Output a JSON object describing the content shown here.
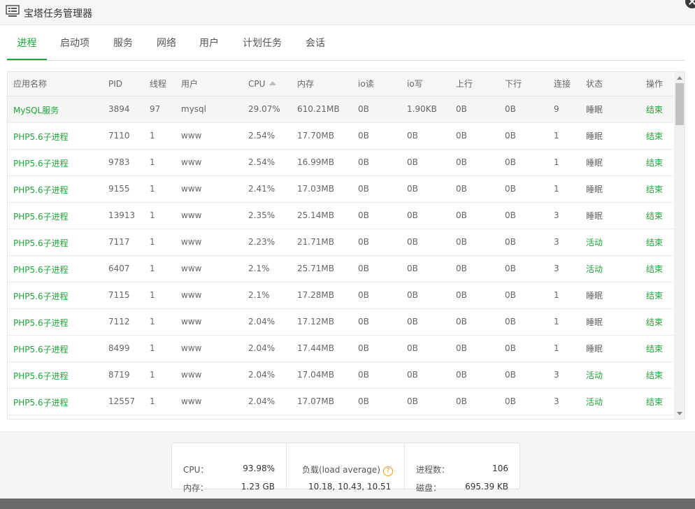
{
  "window": {
    "title": "宝塔任务管理器"
  },
  "tabs": [
    {
      "label": "进程",
      "active": true
    },
    {
      "label": "启动项"
    },
    {
      "label": "服务"
    },
    {
      "label": "网络"
    },
    {
      "label": "用户"
    },
    {
      "label": "计划任务"
    },
    {
      "label": "会话"
    }
  ],
  "table": {
    "columns": [
      "应用名称",
      "PID",
      "线程",
      "用户",
      "CPU",
      "内存",
      "io读",
      "io写",
      "上行",
      "下行",
      "连接",
      "状态",
      "操作"
    ],
    "sort_column": "CPU",
    "rows": [
      {
        "name": "MySQL服务",
        "pid": "3894",
        "threads": "97",
        "user": "mysql",
        "cpu": "29.07%",
        "mem": "610.21MB",
        "io_read": "0B",
        "io_write": "1.90KB",
        "up": "0B",
        "down": "0B",
        "conn": "9",
        "status": "睡眠",
        "active": false,
        "op": "结束"
      },
      {
        "name": "PHP5.6子进程",
        "pid": "7110",
        "threads": "1",
        "user": "www",
        "cpu": "2.54%",
        "mem": "17.70MB",
        "io_read": "0B",
        "io_write": "0B",
        "up": "0B",
        "down": "0B",
        "conn": "1",
        "status": "睡眠",
        "active": false,
        "op": "结束"
      },
      {
        "name": "PHP5.6子进程",
        "pid": "9783",
        "threads": "1",
        "user": "www",
        "cpu": "2.54%",
        "mem": "16.99MB",
        "io_read": "0B",
        "io_write": "0B",
        "up": "0B",
        "down": "0B",
        "conn": "1",
        "status": "睡眠",
        "active": false,
        "op": "结束"
      },
      {
        "name": "PHP5.6子进程",
        "pid": "9155",
        "threads": "1",
        "user": "www",
        "cpu": "2.41%",
        "mem": "17.03MB",
        "io_read": "0B",
        "io_write": "0B",
        "up": "0B",
        "down": "0B",
        "conn": "1",
        "status": "睡眠",
        "active": false,
        "op": "结束"
      },
      {
        "name": "PHP5.6子进程",
        "pid": "13913",
        "threads": "1",
        "user": "www",
        "cpu": "2.35%",
        "mem": "25.14MB",
        "io_read": "0B",
        "io_write": "0B",
        "up": "0B",
        "down": "0B",
        "conn": "3",
        "status": "睡眠",
        "active": false,
        "op": "结束"
      },
      {
        "name": "PHP5.6子进程",
        "pid": "7117",
        "threads": "1",
        "user": "www",
        "cpu": "2.23%",
        "mem": "21.71MB",
        "io_read": "0B",
        "io_write": "0B",
        "up": "0B",
        "down": "0B",
        "conn": "3",
        "status": "活动",
        "active": true,
        "op": "结束"
      },
      {
        "name": "PHP5.6子进程",
        "pid": "6407",
        "threads": "1",
        "user": "www",
        "cpu": "2.1%",
        "mem": "25.71MB",
        "io_read": "0B",
        "io_write": "0B",
        "up": "0B",
        "down": "0B",
        "conn": "3",
        "status": "活动",
        "active": true,
        "op": "结束"
      },
      {
        "name": "PHP5.6子进程",
        "pid": "7115",
        "threads": "1",
        "user": "www",
        "cpu": "2.1%",
        "mem": "17.28MB",
        "io_read": "0B",
        "io_write": "0B",
        "up": "0B",
        "down": "0B",
        "conn": "1",
        "status": "睡眠",
        "active": false,
        "op": "结束"
      },
      {
        "name": "PHP5.6子进程",
        "pid": "7112",
        "threads": "1",
        "user": "www",
        "cpu": "2.04%",
        "mem": "17.12MB",
        "io_read": "0B",
        "io_write": "0B",
        "up": "0B",
        "down": "0B",
        "conn": "1",
        "status": "睡眠",
        "active": false,
        "op": "结束"
      },
      {
        "name": "PHP5.6子进程",
        "pid": "8499",
        "threads": "1",
        "user": "www",
        "cpu": "2.04%",
        "mem": "17.44MB",
        "io_read": "0B",
        "io_write": "0B",
        "up": "0B",
        "down": "0B",
        "conn": "1",
        "status": "睡眠",
        "active": false,
        "op": "结束"
      },
      {
        "name": "PHP5.6子进程",
        "pid": "8719",
        "threads": "1",
        "user": "www",
        "cpu": "2.04%",
        "mem": "17.04MB",
        "io_read": "0B",
        "io_write": "0B",
        "up": "0B",
        "down": "0B",
        "conn": "3",
        "status": "活动",
        "active": true,
        "op": "结束"
      },
      {
        "name": "PHP5.6子进程",
        "pid": "12557",
        "threads": "1",
        "user": "www",
        "cpu": "2.04%",
        "mem": "17.07MB",
        "io_read": "0B",
        "io_write": "0B",
        "up": "0B",
        "down": "0B",
        "conn": "3",
        "status": "活动",
        "active": true,
        "op": "结束"
      }
    ]
  },
  "stats": {
    "cpu_label": "CPU：",
    "cpu_value": "93.98%",
    "mem_label": "内存：",
    "mem_value": "1.23 GB",
    "load_label": "负载(load average)",
    "load_value": "10.18, 10.43, 10.51",
    "proc_label": "进程数：",
    "proc_value": "106",
    "disk_label": "磁盘：",
    "disk_value": "695.39 KB"
  },
  "icons": {
    "window": "monitor-icon",
    "close": "close-icon",
    "help": "help-icon",
    "sort": "sort-asc-icon"
  },
  "colors": {
    "accent": "#20a53a",
    "warning": "#f0a000"
  }
}
